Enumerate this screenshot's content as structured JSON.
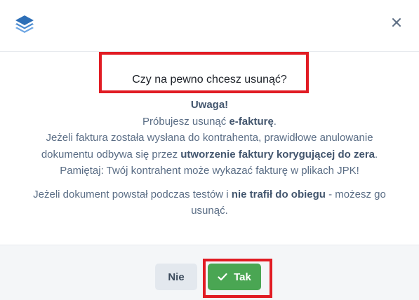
{
  "header": {
    "logo_icon": "stacked-layers-logo",
    "close_icon": "close-icon"
  },
  "dialog": {
    "question": "Czy na pewno chcesz usunąć?",
    "warning_title": "Uwaga!",
    "line1_prefix": "Próbujesz usunąć ",
    "line1_bold": "e-fakturę",
    "line1_suffix": ".",
    "line2_prefix": "Jeżeli faktura została wysłana do kontrahenta, prawidłowe anulowanie dokumentu odbywa się przez ",
    "line2_bold": "utworzenie faktury korygującej do zera",
    "line2_suffix": ".",
    "line3": "Pamiętaj: Twój kontrahent może wykazać fakturę w plikach JPK!",
    "line4_prefix": "Jeżeli dokument powstał podczas testów i ",
    "line4_bold": "nie trafił do obiegu",
    "line4_suffix": " - możesz go usunąć."
  },
  "footer": {
    "no_label": "Nie",
    "yes_label": "Tak",
    "yes_icon": "check-icon"
  },
  "colors": {
    "accent_green": "#4aa653",
    "highlight_red": "#e11c24",
    "logo_blue": "#2d6fb7"
  }
}
